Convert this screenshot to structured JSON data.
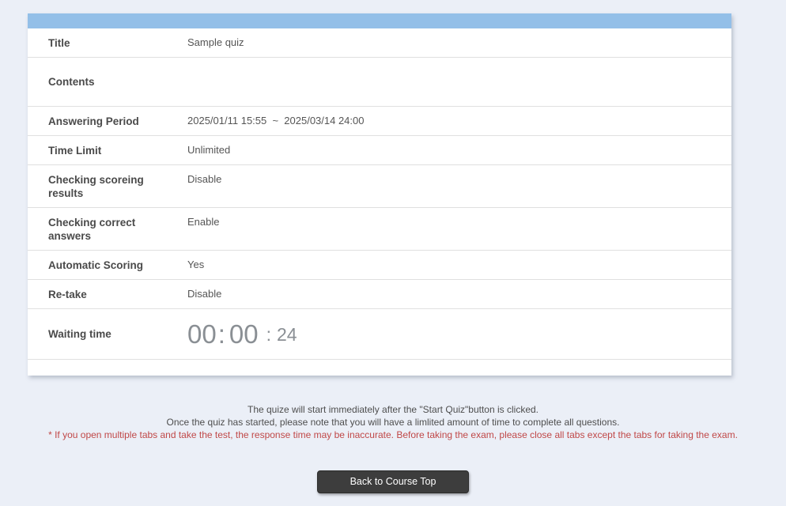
{
  "colors": {
    "accent_bar": "#93bfe8",
    "warning_text": "#c04848",
    "button_bg": "#3d3d3d",
    "page_background": "#ebeff7"
  },
  "table": {
    "rows": [
      {
        "id": "title",
        "label": "Title",
        "value": "Sample quiz"
      },
      {
        "id": "contents",
        "label": "Contents",
        "value": ""
      },
      {
        "id": "answering-period",
        "label": "Answering Period",
        "value": "2025/01/11 15:55  ~  2025/03/14 24:00"
      },
      {
        "id": "time-limit",
        "label": "Time Limit",
        "value": "Unlimited"
      },
      {
        "id": "scoring-results",
        "label": "Checking scoreing results",
        "value": "Disable"
      },
      {
        "id": "correct-answers",
        "label": "Checking correct answers",
        "value": "Enable"
      },
      {
        "id": "automatic-scoring",
        "label": "Automatic Scoring",
        "value": "Yes"
      },
      {
        "id": "retake",
        "label": "Re-take",
        "value": "Disable"
      },
      {
        "id": "waiting-time",
        "label": "Waiting time",
        "value": "",
        "type": "timer"
      }
    ]
  },
  "timer": {
    "hours": "00",
    "minutes": "00",
    "seconds": "24",
    "separator": ":"
  },
  "footer": {
    "line1": "The quize will start immediately after the \"Start Quiz\"button is clicked.",
    "line2": "Once the quiz has started, please note that you will have a limlited amount of time to complete all questions.",
    "warning": "* If you open multiple tabs and take the test, the response time may be inaccurate. Before taking the exam, please close all tabs except the tabs for taking the exam."
  },
  "button": {
    "label": "Back to Course Top"
  }
}
